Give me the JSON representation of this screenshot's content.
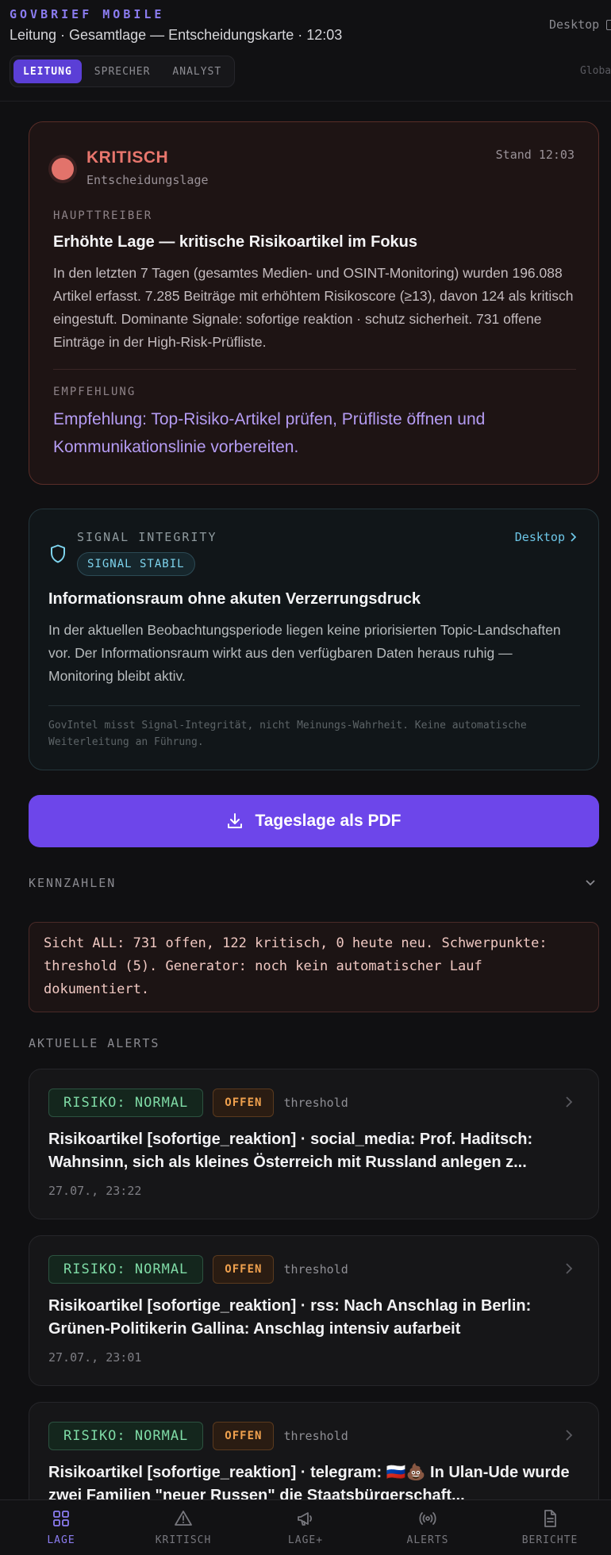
{
  "header": {
    "brand": "GOVBRIEF MOBILE",
    "subtitle": "Leitung · Gesamtlage — Entscheidungskarte · 12:03",
    "desktop_link": "Desktop",
    "global_link": "Globa",
    "roles": [
      "LEITUNG",
      "SPRECHER",
      "ANALYST"
    ],
    "active_role": "LEITUNG"
  },
  "critical": {
    "status": "KRITISCH",
    "status_sub": "Entscheidungslage",
    "stand": "Stand 12:03",
    "driver_label": "HAUPTTREIBER",
    "driver_heading": "Erhöhte Lage — kritische Risikoartikel im Fokus",
    "driver_text": "In den letzten 7 Tagen (gesamtes Medien- und OSINT-Monitoring) wurden 196.088 Artikel erfasst. 7.285 Beiträge mit erhöhtem Risikoscore (≥13), davon 124 als kritisch eingestuft. Dominante Signale: sofortige reaktion · schutz sicherheit. 731 offene Einträge in der High-Risk-Prüfliste.",
    "recommendation_label": "EMPFEHLUNG",
    "recommendation_text": "Empfehlung: Top-Risiko-Artikel prüfen, Prüfliste öffnen und Kommunikationslinie vorbereiten.",
    "accent": "#e8766d"
  },
  "signal": {
    "label": "SIGNAL INTEGRITY",
    "badge": "SIGNAL STABIL",
    "desktop_link": "Desktop",
    "heading": "Informationsraum ohne akuten Verzerrungsdruck",
    "text": "In der aktuellen Beobachtungsperiode liegen keine priorisierten Topic-Landschaften vor. Der Informationsraum wirkt aus den verfügbaren Daten heraus ruhig — Monitoring bleibt aktiv.",
    "note": "GovIntel misst Signal-Integrität, nicht Meinungs-Wahrheit. Keine automatische Weiterleitung an Führung.",
    "accent": "#7ed4ee"
  },
  "pdf_button": "Tageslage als PDF",
  "kennzahlen": {
    "title": "KENNZAHLEN",
    "summary": "Sicht ALL: 731 offen, 122 kritisch, 0 heute neu. Schwerpunkte: threshold (5). Generator: noch kein automatischer Lauf dokumentiert."
  },
  "alerts": {
    "title": "AKTUELLE ALERTS",
    "items": [
      {
        "risk": "RISIKO: NORMAL",
        "status": "OFFEN",
        "tag": "threshold",
        "title": "Risikoartikel [sofortige_reaktion] · social_media: Prof. Haditsch: Wahnsinn, sich als kleines Österreich mit Russland anlegen z...",
        "time": "27.07., 23:22"
      },
      {
        "risk": "RISIKO: NORMAL",
        "status": "OFFEN",
        "tag": "threshold",
        "title": "Risikoartikel [sofortige_reaktion] · rss: Nach Anschlag in Berlin: Grünen-Politikerin Gallina: Anschlag intensiv aufarbeit",
        "time": "27.07., 23:01"
      },
      {
        "risk": "RISIKO: NORMAL",
        "status": "OFFEN",
        "tag": "threshold",
        "title": "Risikoartikel [sofortige_reaktion] · telegram: 🇷🇺💩 In Ulan-Ude wurde zwei Familien \"neuer Russen\" die Staatsbürgerschaft...",
        "time": ""
      }
    ]
  },
  "nav": [
    {
      "label": "LAGE",
      "icon": "grid-icon",
      "active": true
    },
    {
      "label": "KRITISCH",
      "icon": "warning-icon",
      "active": false
    },
    {
      "label": "LAGE+",
      "icon": "megaphone-icon",
      "active": false
    },
    {
      "label": "ALERTS",
      "icon": "broadcast-icon",
      "active": false
    },
    {
      "label": "BERICHTE",
      "icon": "document-icon",
      "active": false
    }
  ],
  "colors": {
    "brand": "#8b7cf0",
    "primary_button": "#6d46ea",
    "risk_normal": "#7fdba6",
    "open_status": "#f0a14e"
  }
}
